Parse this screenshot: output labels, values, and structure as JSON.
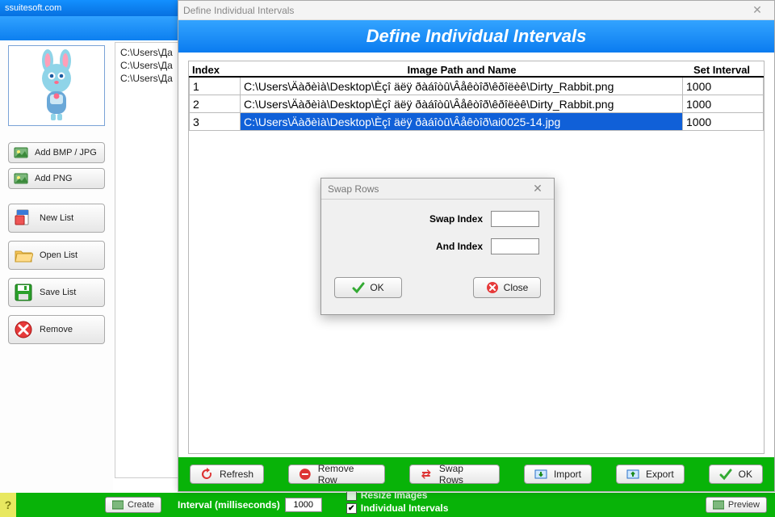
{
  "app": {
    "main_title": "ssuitesoft.com",
    "bottom": {
      "help": "?",
      "create_label": "Create",
      "interval_label": "Interval (milliseconds)",
      "interval_value": "1000",
      "resize_label": "Resize Images",
      "resize_checked": false,
      "individual_label": "Individual Intervals",
      "individual_checked": true
    }
  },
  "sidebar": {
    "add_bmp": "Add BMP / JPG",
    "add_png": "Add PNG",
    "new_list": "New List",
    "open_list": "Open List",
    "save_list": "Save List",
    "remove": "Remove"
  },
  "file_list": [
    "C:\\Users\\Да",
    "C:\\Users\\Да",
    "C:\\Users\\Да"
  ],
  "dialog": {
    "titlebar": "Define Individual Intervals",
    "header": "Define Individual Intervals",
    "columns": {
      "index": "Index",
      "path": "Image Path and Name",
      "interval": "Set Interval"
    },
    "rows": [
      {
        "index": "1",
        "path": "C:\\Users\\Äàðèìà\\Desktop\\Èçî äëÿ ðàáîòû\\Âåêòîð\\êðîëèê\\Dirty_Rabbit.png",
        "interval": "1000",
        "selected": false
      },
      {
        "index": "2",
        "path": "C:\\Users\\Äàðèìà\\Desktop\\Èçî äëÿ ðàáîòû\\Âåêòîð\\êðîëèê\\Dirty_Rabbit.png",
        "interval": "1000",
        "selected": false
      },
      {
        "index": "3",
        "path": "C:\\Users\\Äàðèìà\\Desktop\\Èçî äëÿ ðàáîòû\\Âåêòîð\\ai0025-14.jpg",
        "interval": "1000",
        "selected": true
      }
    ],
    "footer": {
      "refresh": "Refresh",
      "remove_row": "Remove Row",
      "swap_rows": "Swap Rows",
      "import": "Import",
      "export": "Export",
      "ok": "OK",
      "preview": "Preview"
    }
  },
  "swap": {
    "title": "Swap Rows",
    "swap_index_label": "Swap Index",
    "and_index_label": "And Index",
    "swap_index_value": "",
    "and_index_value": "",
    "ok": "OK",
    "close": "Close"
  }
}
